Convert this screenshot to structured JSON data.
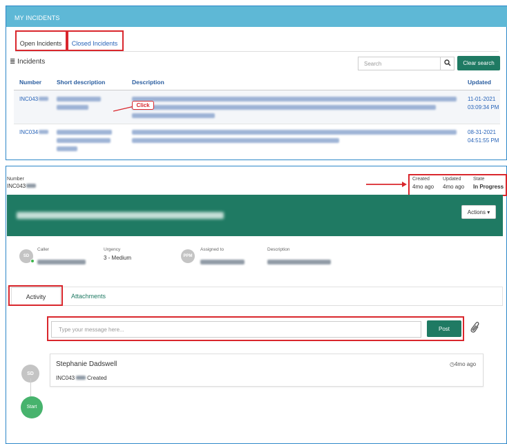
{
  "list_panel": {
    "header": "MY INCIDENTS",
    "tabs": [
      "Open Incidents",
      "Closed Incidents"
    ],
    "list_title": "Incidents",
    "list_icon": "list-icon",
    "search_placeholder": "Search",
    "clear_label": "Clear search",
    "columns": [
      "Number",
      "Short description",
      "Description",
      "Updated"
    ],
    "rows": [
      {
        "number": "INC043",
        "updated_date": "11-01-2021",
        "updated_time": "03:09:34 PM"
      },
      {
        "number": "INC034",
        "updated_date": "08-31-2021",
        "updated_time": "04:51:55 PM"
      }
    ],
    "callout": "Click"
  },
  "detail": {
    "number_label": "Number",
    "number_value": "INC043",
    "meta": [
      {
        "label": "Created",
        "value": "4mo ago"
      },
      {
        "label": "Updated",
        "value": "4mo ago"
      },
      {
        "label": "State",
        "value": "In Progress"
      }
    ],
    "actions_label": "Actions ▾",
    "fields": [
      {
        "label": "Caller",
        "initials": "SD"
      },
      {
        "label": "Urgency",
        "value": "3 - Medium"
      },
      {
        "label": "Assigned to",
        "initials": "PPM"
      },
      {
        "label": "Description"
      }
    ],
    "tabs": [
      "Activity",
      "Attachments"
    ],
    "message_placeholder": "Type your message here...",
    "post_label": "Post",
    "activity": {
      "author": "Stephanie Dadswell",
      "initials": "SD",
      "time": "4mo ago",
      "entry_number": "INC043",
      "entry_text": "Created"
    },
    "start_label": "Start"
  },
  "colors": {
    "accent": "#1f7a63",
    "header": "#5eb8d6",
    "highlight": "#d9262c"
  }
}
